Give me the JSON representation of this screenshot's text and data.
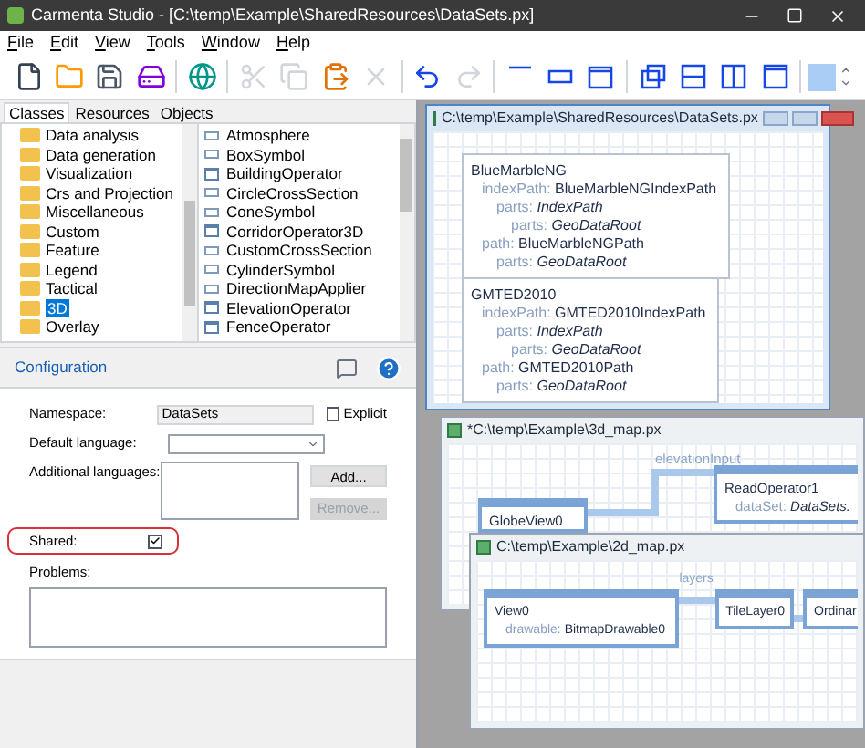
{
  "window": {
    "title": "Carmenta Studio - [C:\\temp\\Example\\SharedResources\\DataSets.px]"
  },
  "menu": [
    {
      "label": "File"
    },
    {
      "label": "Edit"
    },
    {
      "label": "View"
    },
    {
      "label": "Tools"
    },
    {
      "label": "Window"
    },
    {
      "label": "Help"
    }
  ],
  "toolbar": [
    {
      "kind": "new",
      "disabled": false
    },
    {
      "kind": "open",
      "disabled": false
    },
    {
      "kind": "save",
      "disabled": false
    },
    {
      "kind": "save-all",
      "disabled": false
    },
    {
      "kind": "globe",
      "disabled": false
    },
    {
      "kind": "cut",
      "disabled": true
    },
    {
      "kind": "copy",
      "disabled": true
    },
    {
      "kind": "paste",
      "disabled": false
    },
    {
      "kind": "delete",
      "disabled": true
    },
    {
      "kind": "undo",
      "disabled": false
    },
    {
      "kind": "redo",
      "disabled": true
    },
    {
      "kind": "layout-top",
      "disabled": false
    },
    {
      "kind": "layout-box",
      "disabled": false
    },
    {
      "kind": "layout-frame",
      "disabled": false
    },
    {
      "kind": "cascade",
      "disabled": false
    },
    {
      "kind": "tile-h",
      "disabled": false
    },
    {
      "kind": "tile-v",
      "disabled": false
    },
    {
      "kind": "maximize",
      "disabled": false
    },
    {
      "kind": "color",
      "disabled": false
    }
  ],
  "tabs": [
    {
      "label": "Classes",
      "selected": true
    },
    {
      "label": "Resources",
      "selected": false
    },
    {
      "label": "Objects",
      "selected": false
    }
  ],
  "categories": [
    {
      "label": "Data analysis",
      "selected": false
    },
    {
      "label": "Data generation",
      "selected": false
    },
    {
      "label": "Visualization",
      "selected": false
    },
    {
      "label": "Crs and Projection",
      "selected": false
    },
    {
      "label": "Miscellaneous",
      "selected": false
    },
    {
      "label": "Custom",
      "selected": false
    },
    {
      "label": "Feature",
      "selected": false
    },
    {
      "label": "Legend",
      "selected": false
    },
    {
      "label": "Tactical",
      "selected": false
    },
    {
      "label": "3D",
      "selected": true
    },
    {
      "label": "Overlay",
      "selected": false
    }
  ],
  "classes": [
    {
      "label": "Atmosphere",
      "kind": "object"
    },
    {
      "label": "BoxSymbol",
      "kind": "object"
    },
    {
      "label": "BuildingOperator",
      "kind": "operator"
    },
    {
      "label": "CircleCrossSection",
      "kind": "object"
    },
    {
      "label": "ConeSymbol",
      "kind": "object"
    },
    {
      "label": "CorridorOperator3D",
      "kind": "operator"
    },
    {
      "label": "CustomCrossSection",
      "kind": "object"
    },
    {
      "label": "CylinderSymbol",
      "kind": "object"
    },
    {
      "label": "DirectionMapApplier",
      "kind": "object"
    },
    {
      "label": "ElevationOperator",
      "kind": "operator"
    },
    {
      "label": "FenceOperator",
      "kind": "operator"
    }
  ],
  "configuration": {
    "title": "Configuration",
    "namespace": {
      "label": "Namespace:",
      "value": "DataSets"
    },
    "explicit": {
      "label": "Explicit",
      "checked": false
    },
    "default_language": {
      "label": "Default language:"
    },
    "additional_languages": {
      "label": "Additional languages:"
    },
    "add_button": {
      "label": "Add...",
      "disabled": false
    },
    "remove_button": {
      "label": "Remove...",
      "disabled": true
    },
    "shared": {
      "label": "Shared:",
      "checked": true,
      "highlighted": true
    },
    "problems": {
      "label": "Problems:"
    }
  },
  "documents": [
    {
      "title": "C:\\temp\\Example\\SharedResources\\DataSets.px",
      "active": true,
      "nodes": [
        {
          "name": "BlueMarbleNG",
          "properties": [
            {
              "label": "indexPath:",
              "value": "BlueMarbleNGIndexPath",
              "italic": false,
              "children": [
                {
                  "label": "parts:",
                  "value": "IndexPath",
                  "italic": true,
                  "children": [
                    {
                      "label": "parts:",
                      "value": "GeoDataRoot",
                      "italic": true
                    }
                  ]
                }
              ]
            },
            {
              "label": "path:",
              "value": "BlueMarbleNGPath",
              "italic": false,
              "children": [
                {
                  "label": "parts:",
                  "value": "GeoDataRoot",
                  "italic": true
                }
              ]
            }
          ]
        },
        {
          "name": "GMTED2010",
          "properties": [
            {
              "label": "indexPath:",
              "value": "GMTED2010IndexPath",
              "italic": false,
              "children": [
                {
                  "label": "parts:",
                  "value": "IndexPath",
                  "italic": true,
                  "children": [
                    {
                      "label": "parts:",
                      "value": "GeoDataRoot",
                      "italic": true
                    }
                  ]
                }
              ]
            },
            {
              "label": "path:",
              "value": "GMTED2010Path",
              "italic": false,
              "children": [
                {
                  "label": "parts:",
                  "value": "GeoDataRoot",
                  "italic": true
                }
              ]
            }
          ]
        }
      ]
    },
    {
      "title": "*C:\\temp\\Example\\3d_map.px",
      "active": false,
      "nodes": [
        {
          "name": "GlobeView0"
        },
        {
          "name": "ReadOperator1",
          "properties": [
            {
              "label": "dataSet:",
              "value": "DataSets.",
              "italic": true
            }
          ]
        }
      ],
      "links": [
        {
          "label": "elevationInput"
        }
      ]
    },
    {
      "title": "C:\\temp\\Example\\2d_map.px",
      "active": false,
      "nodes": [
        {
          "name": "View0",
          "properties": [
            {
              "label": "drawable:",
              "value": "BitmapDrawable0",
              "italic": false
            }
          ]
        },
        {
          "name": "TileLayer0"
        },
        {
          "name": "Ordinar"
        }
      ],
      "links": [
        {
          "label": "layers"
        }
      ]
    }
  ]
}
